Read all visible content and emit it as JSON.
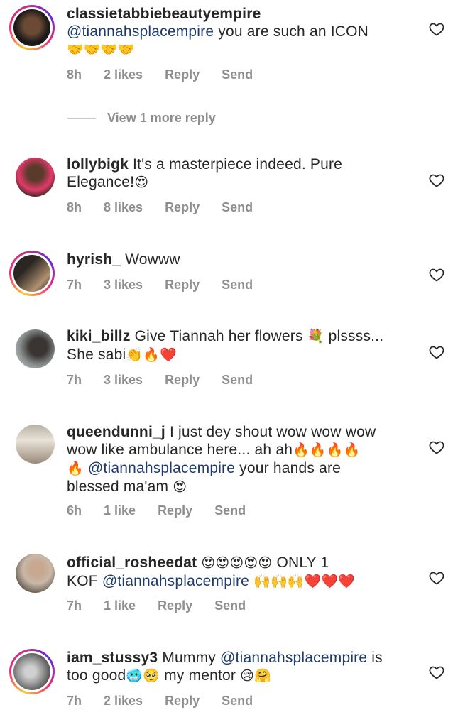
{
  "comments": [
    {
      "username": "classietabbiebeautyempire",
      "text_parts": [
        {
          "type": "mention",
          "text": "@tiannahsplacempire"
        },
        {
          "type": "text",
          "text": " you are such an ICON"
        },
        {
          "type": "br"
        },
        {
          "type": "emoji",
          "text": "🤝🤝🤝🤝"
        }
      ],
      "time": "8h",
      "likes": "2 likes",
      "reply": "Reply",
      "send": "Send",
      "avatar_colors": [
        "#1c1a18",
        "#6a4a35"
      ],
      "story_ring": true
    },
    {
      "username": "lollybigk",
      "text_parts": [
        {
          "type": "text",
          "text": " It's a masterpiece indeed. Pure"
        },
        {
          "type": "br"
        },
        {
          "type": "text",
          "text": "Elegance!"
        },
        {
          "type": "emoji",
          "text": "😍"
        }
      ],
      "time": "8h",
      "likes": "8 likes",
      "reply": "Reply",
      "send": "Send",
      "avatar_colors": [
        "#e23a6a",
        "#3a2520"
      ],
      "story_ring": false
    },
    {
      "username": "hyrish_",
      "text_parts": [
        {
          "type": "text",
          "text": " Wowww"
        }
      ],
      "time": "7h",
      "likes": "3 likes",
      "reply": "Reply",
      "send": "Send",
      "avatar_colors": [
        "#6b5a48",
        "#2a2622"
      ],
      "story_ring": true
    },
    {
      "username": "kiki_billz",
      "text_parts": [
        {
          "type": "text",
          "text": " Give Tiannah her flowers "
        },
        {
          "type": "emoji",
          "text": "💐"
        },
        {
          "type": "text",
          "text": " plssss..."
        },
        {
          "type": "br"
        },
        {
          "type": "text",
          "text": "She sabi"
        },
        {
          "type": "emoji",
          "text": "👏🔥❤️"
        }
      ],
      "time": "7h",
      "likes": "3 likes",
      "reply": "Reply",
      "send": "Send",
      "avatar_colors": [
        "#8a9090",
        "#3a3432"
      ],
      "story_ring": false
    },
    {
      "username": "queendunni_j",
      "text_parts": [
        {
          "type": "text",
          "text": " I just dey shout wow wow wow"
        },
        {
          "type": "br"
        },
        {
          "type": "text",
          "text": "wow like ambulance here... ah ah"
        },
        {
          "type": "emoji",
          "text": "🔥🔥🔥🔥"
        },
        {
          "type": "br"
        },
        {
          "type": "emoji",
          "text": "🔥"
        },
        {
          "type": "text",
          "text": " "
        },
        {
          "type": "mention",
          "text": "@tiannahsplacempire"
        },
        {
          "type": "text",
          "text": " your hands are"
        },
        {
          "type": "br"
        },
        {
          "type": "text",
          "text": "blessed ma'am "
        },
        {
          "type": "emoji",
          "text": "😍"
        }
      ],
      "time": "6h",
      "likes": "1 like",
      "reply": "Reply",
      "send": "Send",
      "avatar_colors": [
        "#d8d2c8",
        "#9a8a7a"
      ],
      "story_ring": false
    },
    {
      "username": "official_rosheedat",
      "text_parts": [
        {
          "type": "text",
          "text": " "
        },
        {
          "type": "emoji",
          "text": "😍😍😍😍😍"
        },
        {
          "type": "text",
          "text": " ONLY 1"
        },
        {
          "type": "br"
        },
        {
          "type": "text",
          "text": "KOF "
        },
        {
          "type": "mention",
          "text": "@tiannahsplacempire"
        },
        {
          "type": "text",
          "text": " "
        },
        {
          "type": "emoji",
          "text": "🙌🙌🙌❤️❤️❤️"
        }
      ],
      "time": "7h",
      "likes": "1 like",
      "reply": "Reply",
      "send": "Send",
      "avatar_colors": [
        "#c8b8a8",
        "#4a4038"
      ],
      "story_ring": false
    },
    {
      "username": "iam_stussy3",
      "text_parts": [
        {
          "type": "text",
          "text": " Mummy "
        },
        {
          "type": "mention",
          "text": "@tiannahsplacempire"
        },
        {
          "type": "text",
          "text": " is"
        },
        {
          "type": "br"
        },
        {
          "type": "text",
          "text": "too good"
        },
        {
          "type": "emoji",
          "text": "🥶🥺"
        },
        {
          "type": "text",
          "text": " my mentor "
        },
        {
          "type": "emoji",
          "text": "😢🤗"
        }
      ],
      "time": "7h",
      "likes": "2 likes",
      "reply": "Reply",
      "send": "Send",
      "avatar_colors": [
        "#9a9a9a",
        "#3a3a3a"
      ],
      "story_ring": true
    }
  ],
  "view_more_replies": "View 1 more reply",
  "colors": {
    "mention": "#1e3a6b",
    "meta": "#8e8e8e",
    "text": "#262626"
  },
  "icons": {
    "like": "heart-outline-icon"
  }
}
